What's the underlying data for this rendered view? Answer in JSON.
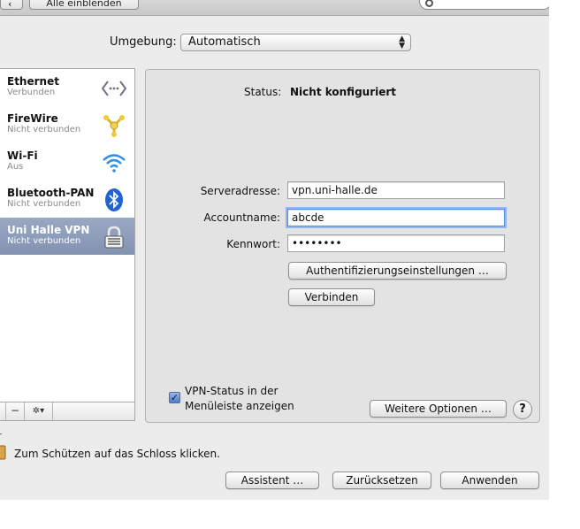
{
  "toolbar": {
    "show_all_label": "Alle einblenden"
  },
  "environment": {
    "label": "Umgebung:",
    "selected": "Automatisch"
  },
  "services": [
    {
      "name": "Ethernet",
      "status": "Verbunden",
      "icon": "ethernet-icon"
    },
    {
      "name": "FireWire",
      "status": "Nicht verbunden",
      "icon": "firewire-icon"
    },
    {
      "name": "Wi-Fi",
      "status": "Aus",
      "icon": "wifi-icon"
    },
    {
      "name": "Bluetooth-PAN",
      "status": "Nicht verbunden",
      "icon": "bluetooth-icon"
    },
    {
      "name": "Uni Halle VPN",
      "status": "Nicht verbunden",
      "icon": "vpn-lock-icon",
      "selected": true
    }
  ],
  "sidebar_tools": {
    "remove": "−",
    "action": "✲▾"
  },
  "vpn": {
    "status_label": "Status:",
    "status_value": "Nicht konfiguriert",
    "server_label": "Serveradresse:",
    "server_value": "vpn.uni-halle.de",
    "account_label": "Accountname:",
    "account_value": "abcde",
    "password_label": "Kennwort:",
    "password_value": "••••••••",
    "auth_button": "Authentifizierungseinstellungen …",
    "connect_button": "Verbinden",
    "show_status_label_line1": "VPN-Status in der",
    "show_status_label_line2": "Menüleiste anzeigen",
    "show_status_checked": true,
    "advanced_button": "Weitere Optionen …",
    "help_button": "?"
  },
  "footer": {
    "lock_text": "Zum Schützen auf das Schloss klicken.",
    "assistant_button": "Assistent …",
    "revert_button": "Zurücksetzen",
    "apply_button": "Anwenden"
  },
  "colors": {
    "selection": "#8a99b7",
    "focus_ring": "#8fb6ee",
    "window_bg": "#ececec"
  }
}
